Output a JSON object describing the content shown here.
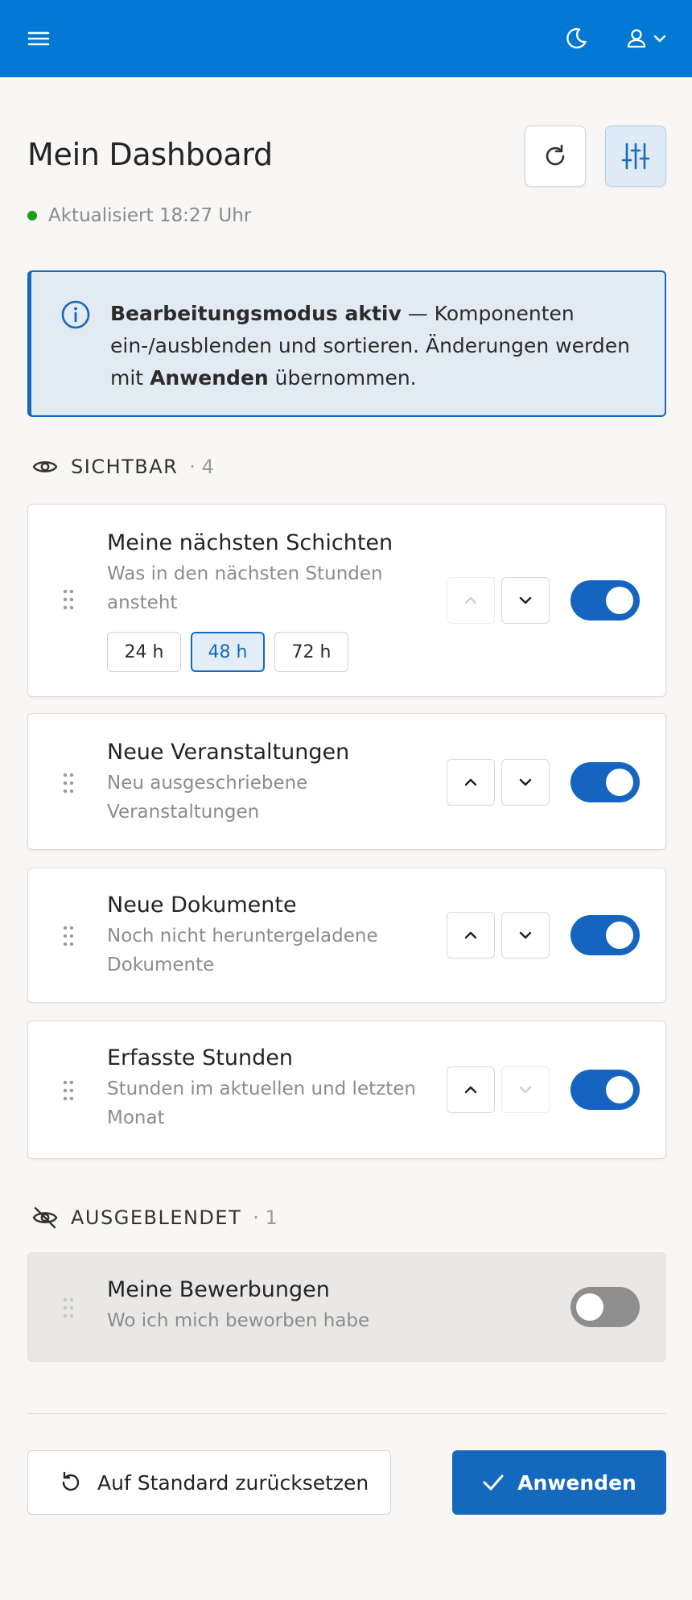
{
  "header": {
    "menu_icon": "hamburger-icon",
    "theme_icon": "moon-icon",
    "user_icon": "user-icon"
  },
  "page": {
    "title": "Mein Dashboard",
    "status": "Aktualisiert 18:27 Uhr",
    "status_color": "#13a10e"
  },
  "info": {
    "bold": "Bearbeitungsmodus aktiv",
    "text1": " — Komponenten ein-/ausblenden und sortieren. Änderungen werden mit ",
    "bold2": "Anwenden",
    "text2": " übernommen."
  },
  "visible_section": {
    "label": "SICHTBAR",
    "count": "· 4"
  },
  "hidden_section": {
    "label": "AUSGEBLENDET",
    "count": "· 1"
  },
  "cards": [
    {
      "title": "Meine nächsten Schichten",
      "desc": "Was in den nächsten Stunden ansteht",
      "up_enabled": false,
      "down_enabled": true,
      "enabled": true,
      "ranges": [
        "24 h",
        "48 h",
        "72 h"
      ],
      "selected_range": "48 h"
    },
    {
      "title": "Neue Veranstaltungen",
      "desc": "Neu ausgeschriebene Veranstaltungen",
      "up_enabled": true,
      "down_enabled": true,
      "enabled": true
    },
    {
      "title": "Neue Dokumente",
      "desc": "Noch nicht heruntergeladene Dokumente",
      "up_enabled": true,
      "down_enabled": true,
      "enabled": true
    },
    {
      "title": "Erfasste Stunden",
      "desc": "Stunden im aktuellen und letzten Monat",
      "up_enabled": true,
      "down_enabled": false,
      "enabled": true
    }
  ],
  "hidden_cards": [
    {
      "title": "Meine Bewerbungen",
      "desc": "Wo ich mich beworben habe",
      "enabled": false
    }
  ],
  "footer": {
    "reset_label": "Auf Standard zurücksetzen",
    "apply_label": "Anwenden"
  },
  "colors": {
    "header": "#0078d4",
    "accent": "#1569bd",
    "toggle_on": "#1565c0"
  }
}
